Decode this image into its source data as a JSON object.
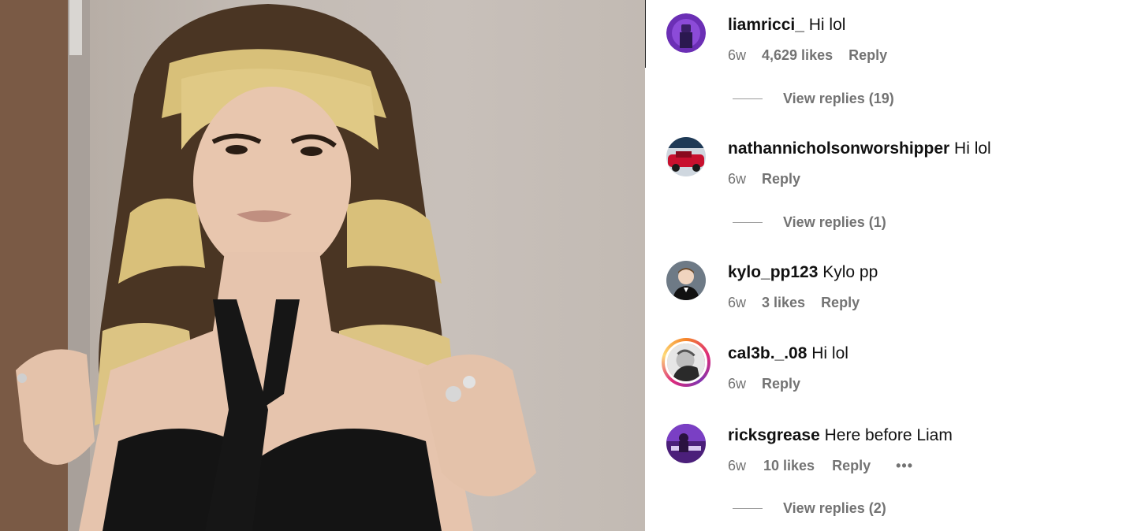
{
  "photo": {
    "alt_icon": "portrait-photo",
    "colors": {
      "background": "#c3bbb4",
      "hair_dark": "#4a3523",
      "hair_light": "#d9c07a",
      "dress": "#141414",
      "skin": "#e6c4ad"
    }
  },
  "comments": [
    {
      "username": "liamricci_",
      "text": "Hi lol",
      "age": "6w",
      "likes": "4,629 likes",
      "reply": "Reply",
      "view_replies": "View replies (19)",
      "avatar_icon": "purple-figure-avatar"
    },
    {
      "username": "nathannicholsonworshipper",
      "text": "Hi lol",
      "age": "6w",
      "likes": "",
      "reply": "Reply",
      "view_replies": "View replies (1)",
      "avatar_icon": "race-car-avatar"
    },
    {
      "username": "kylo_pp123",
      "text": "Kylo pp",
      "age": "6w",
      "likes": "3 likes",
      "reply": "Reply",
      "view_replies": "",
      "avatar_icon": "boy-portrait-avatar"
    },
    {
      "username": "cal3b._.08",
      "text": "Hi lol",
      "age": "6w",
      "likes": "",
      "reply": "Reply",
      "view_replies": "",
      "avatar_icon": "story-ring-avatar"
    },
    {
      "username": "ricksgrease",
      "text": "Here before Liam",
      "age": "6w",
      "likes": "10 likes",
      "reply": "Reply",
      "more": "•••",
      "view_replies": "View replies (2)",
      "avatar_icon": "purple-room-avatar"
    }
  ],
  "colors": {
    "meta_gray": "#737373",
    "text": "#111111",
    "story_ring": "#dd2a7b"
  }
}
